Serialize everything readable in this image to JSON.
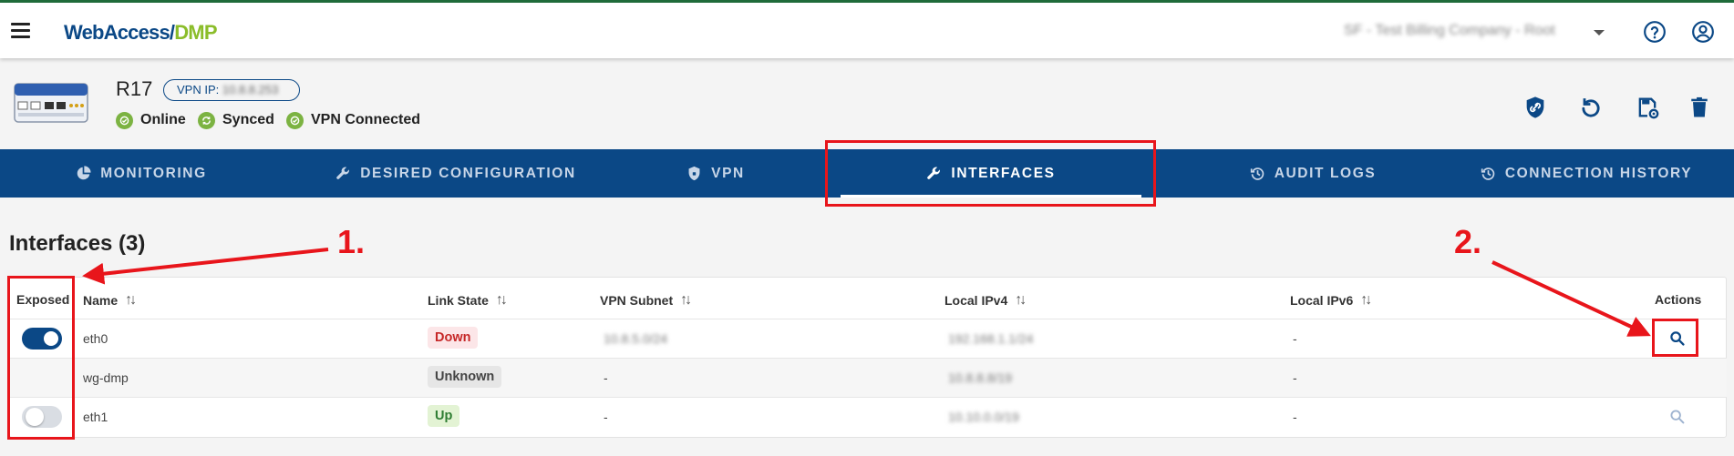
{
  "header": {
    "logo_part1": "WebAccess/",
    "logo_part2": "DMP",
    "company": "SF - Test Billing Company - Root"
  },
  "device": {
    "name": "R17",
    "vpn_ip_label": "VPN IP:",
    "vpn_ip_value": "10.8.8.253",
    "statuses": [
      "Online",
      "Synced",
      "VPN Connected"
    ]
  },
  "tabs": [
    "MONITORING",
    "DESIRED CONFIGURATION",
    "VPN",
    "INTERFACES",
    "AUDIT LOGS",
    "CONNECTION HISTORY"
  ],
  "active_tab": "INTERFACES",
  "section_title": "Interfaces (3)",
  "table": {
    "columns": [
      "Exposed",
      "Name",
      "Link State",
      "VPN Subnet",
      "Local IPv4",
      "Local IPv6",
      "Actions"
    ],
    "rows": [
      {
        "exposed": true,
        "name": "eth0",
        "link_state": "Down",
        "vpn_subnet": "10.8.5.0/24",
        "local_ipv4": "192.168.1.1/24",
        "local_ipv6": "-"
      },
      {
        "exposed": null,
        "name": "wg-dmp",
        "link_state": "Unknown",
        "vpn_subnet": "-",
        "local_ipv4": "10.8.8.8/19",
        "local_ipv6": "-"
      },
      {
        "exposed": false,
        "name": "eth1",
        "link_state": "Up",
        "vpn_subnet": "-",
        "local_ipv4": "10.10.0.0/19",
        "local_ipv6": "-"
      }
    ]
  },
  "annotations": [
    "1.",
    "2."
  ],
  "colors": {
    "brand_blue": "#0b4886",
    "brand_green": "#8bbd2a",
    "annotation_red": "#e8151b"
  }
}
